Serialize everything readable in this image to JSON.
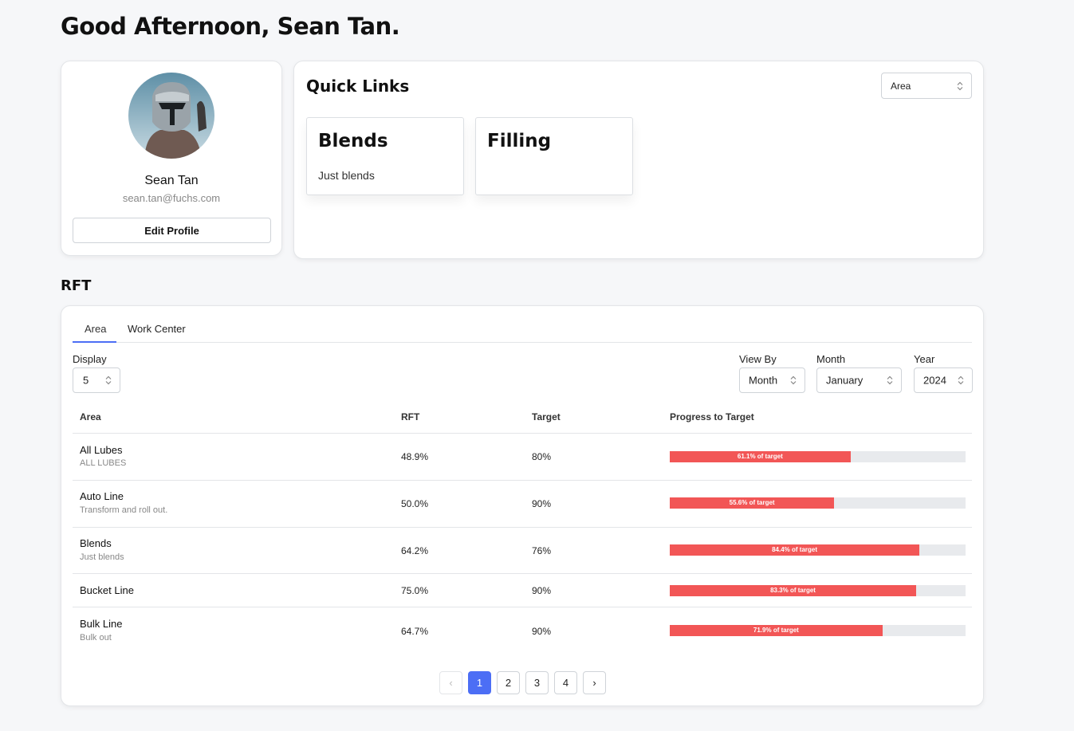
{
  "greeting": "Good Afternoon, Sean Tan.",
  "profile": {
    "name": "Sean Tan",
    "email": "sean.tan@fuchs.com",
    "edit_label": "Edit Profile"
  },
  "quick_links": {
    "title": "Quick Links",
    "filter_value": "Area",
    "items": [
      {
        "title": "Blends",
        "description": "Just blends"
      },
      {
        "title": "Filling",
        "description": ""
      }
    ]
  },
  "rft": {
    "heading": "RFT",
    "tabs": [
      {
        "label": "Area",
        "active": true
      },
      {
        "label": "Work Center",
        "active": false
      }
    ],
    "display": {
      "label": "Display",
      "value": "5"
    },
    "view_by": {
      "label": "View By",
      "value": "Month"
    },
    "month": {
      "label": "Month",
      "value": "January"
    },
    "year": {
      "label": "Year",
      "value": "2024"
    },
    "columns": [
      "Area",
      "RFT",
      "Target",
      "Progress to Target"
    ],
    "rows": [
      {
        "name": "All Lubes",
        "sub": "ALL LUBES",
        "rft": "48.9%",
        "target": "80%",
        "progress": 61.1,
        "progress_label": "61.1% of target"
      },
      {
        "name": "Auto Line",
        "sub": "Transform and roll out.",
        "rft": "50.0%",
        "target": "90%",
        "progress": 55.6,
        "progress_label": "55.6% of target"
      },
      {
        "name": "Blends",
        "sub": "Just blends",
        "rft": "64.2%",
        "target": "76%",
        "progress": 84.4,
        "progress_label": "84.4% of target"
      },
      {
        "name": "Bucket Line",
        "sub": "",
        "rft": "75.0%",
        "target": "90%",
        "progress": 83.3,
        "progress_label": "83.3% of target"
      },
      {
        "name": "Bulk Line",
        "sub": "Bulk out",
        "rft": "64.7%",
        "target": "90%",
        "progress": 71.9,
        "progress_label": "71.9% of target"
      }
    ],
    "pagination": {
      "prev": "‹",
      "next": "›",
      "pages": [
        "1",
        "2",
        "3",
        "4"
      ],
      "current": "1"
    }
  },
  "colors": {
    "accent": "#4c6ef5",
    "progress_fill": "#f25656",
    "progress_track": "#e8eaed"
  }
}
